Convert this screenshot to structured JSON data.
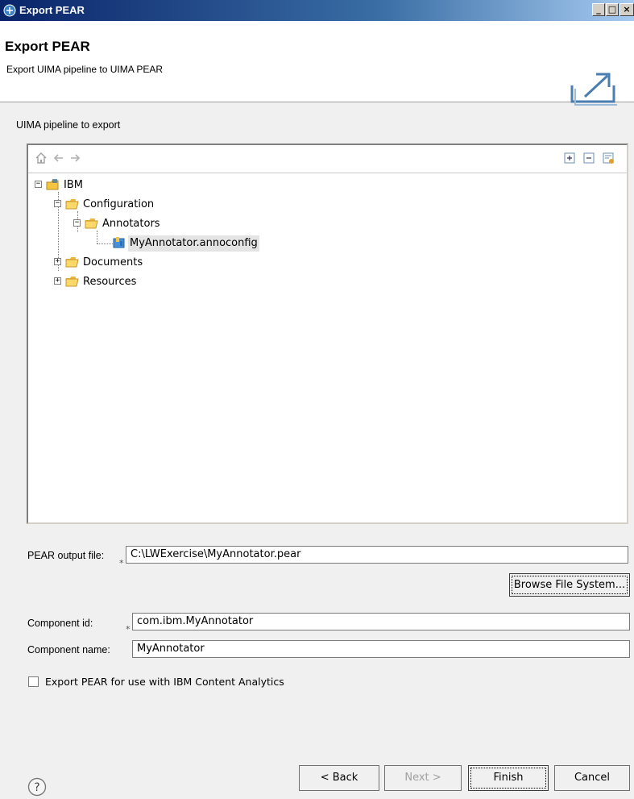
{
  "window": {
    "title": "Export PEAR",
    "controls": [
      "minimize",
      "maximize",
      "close"
    ]
  },
  "banner": {
    "title": "Export PEAR",
    "description": "Export UIMA pipeline to UIMA PEAR",
    "icon": "export-icon"
  },
  "pipeline_label": "UIMA pipeline to export",
  "tree_toolbar": {
    "left": [
      "home-icon",
      "back-arrow-icon",
      "forward-arrow-icon"
    ],
    "right": [
      "expand-all-icon",
      "collapse-all-icon",
      "view-menu-icon"
    ]
  },
  "tree": [
    {
      "label": "IBM",
      "icon": "project-icon",
      "expanded": true,
      "level": 0
    },
    {
      "label": "Configuration",
      "icon": "folder-icon",
      "expanded": true,
      "level": 1
    },
    {
      "label": "Annotators",
      "icon": "folder-icon",
      "expanded": true,
      "level": 2
    },
    {
      "label": "MyAnnotator.annoconfig",
      "icon": "annotator-config-icon",
      "level": 3,
      "selected": true
    },
    {
      "label": "Documents",
      "icon": "folder-icon",
      "expanded": false,
      "level": 1
    },
    {
      "label": "Resources",
      "icon": "folder-icon",
      "expanded": false,
      "level": 1
    }
  ],
  "form": {
    "pear_output_label": "PEAR output file:",
    "pear_output_value": "C:\\LWExercise\\MyAnnotator.pear",
    "browse_label": "Browse File System...",
    "component_id_label": "Component id:",
    "component_id_value": "com.ibm.MyAnnotator",
    "component_name_label": "Component name:",
    "component_name_value": "MyAnnotator",
    "required_marker": "*",
    "checkbox_label": "Export PEAR for use with IBM Content Analytics",
    "checkbox_checked": false
  },
  "footer": {
    "back": "< Back",
    "next": "Next >",
    "finish": "Finish",
    "cancel": "Cancel"
  },
  "colors": {
    "titlebar": "#0a246a",
    "folder": "#f5c542",
    "selection": "#e4e4e4"
  }
}
